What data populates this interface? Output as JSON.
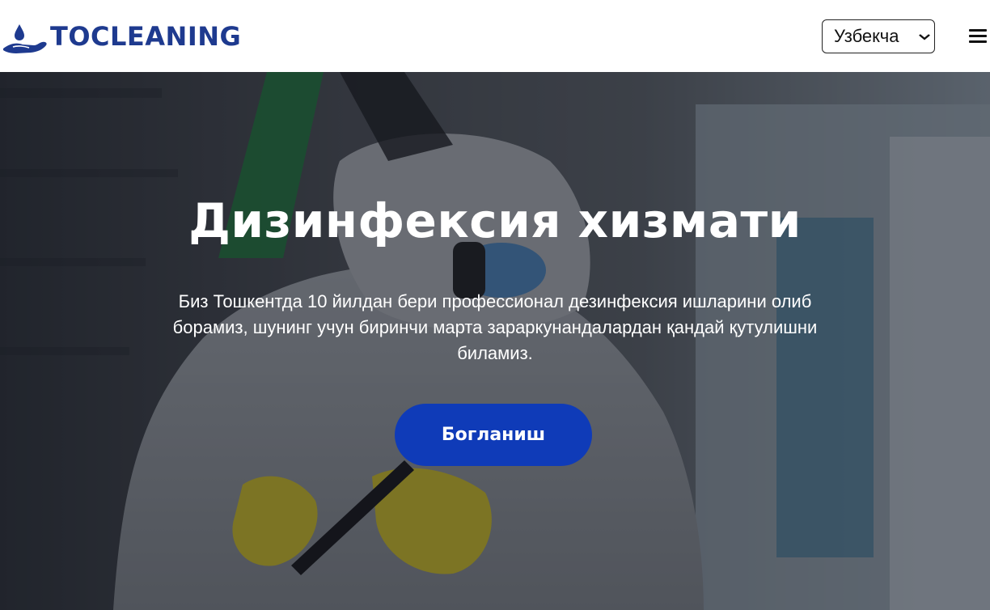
{
  "header": {
    "logo_text": "TOCLEANING",
    "language_selected": "Узбекча"
  },
  "hero": {
    "title": "Дизинфексия хизмати",
    "description": "Биз Тошкентда 10 йилдан бери профессионал дезинфексия ишларини олиб борамиз, шунинг учун биринчи марта зараркунандалардан қандай қутулишни биламиз.",
    "cta_label": "Богланиш"
  },
  "colors": {
    "brand": "#1e3a8f",
    "cta": "#0f3bb8"
  },
  "icons": {
    "logo": "hand-water-drop-icon",
    "menu": "hamburger-menu-icon",
    "select_arrow": "chevron-down-icon"
  }
}
